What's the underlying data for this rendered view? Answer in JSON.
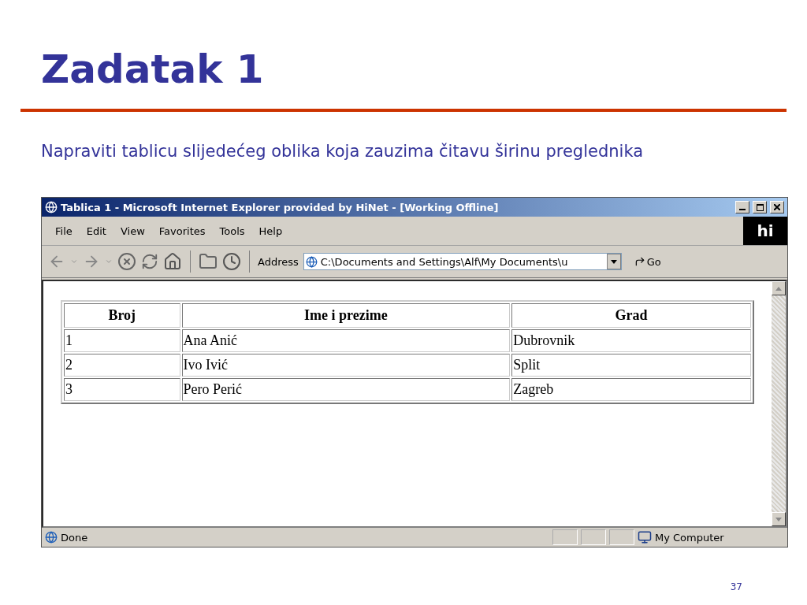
{
  "slide": {
    "title": "Zadatak 1",
    "subtitle": "Napraviti tablicu slijedećeg oblika koja zauzima čitavu širinu preglednika",
    "page_number": "37"
  },
  "browser": {
    "title": "Tablica 1 - Microsoft Internet Explorer provided by HiNet - [Working Offline]",
    "menu": [
      "File",
      "Edit",
      "View",
      "Favorites",
      "Tools",
      "Help"
    ],
    "logo": "hi",
    "address_label": "Address",
    "address": "C:\\Documents and Settings\\Alf\\My Documents\\u",
    "go": "Go",
    "table": {
      "columns": [
        "Broj",
        "Ime i prezime",
        "Grad"
      ],
      "rows": [
        [
          "1",
          "Ana Anić",
          "Dubrovnik"
        ],
        [
          "2",
          "Ivo Ivić",
          "Split"
        ],
        [
          "3",
          "Pero Perić",
          "Zagreb"
        ]
      ]
    },
    "status": {
      "text": "Done",
      "zone": "My Computer"
    }
  }
}
